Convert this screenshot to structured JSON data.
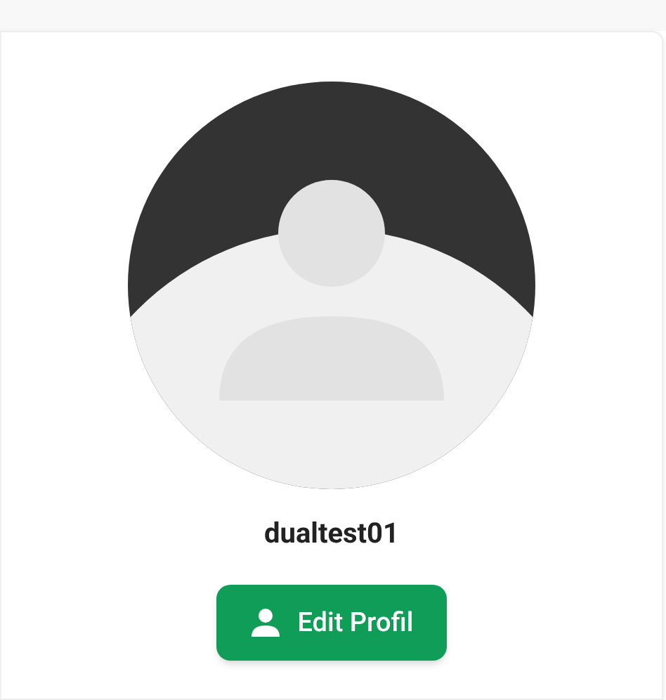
{
  "profile": {
    "username": "dualtest01"
  },
  "buttons": [
    {
      "label": "Edit Profil",
      "kind": "edit-profile"
    }
  ]
}
